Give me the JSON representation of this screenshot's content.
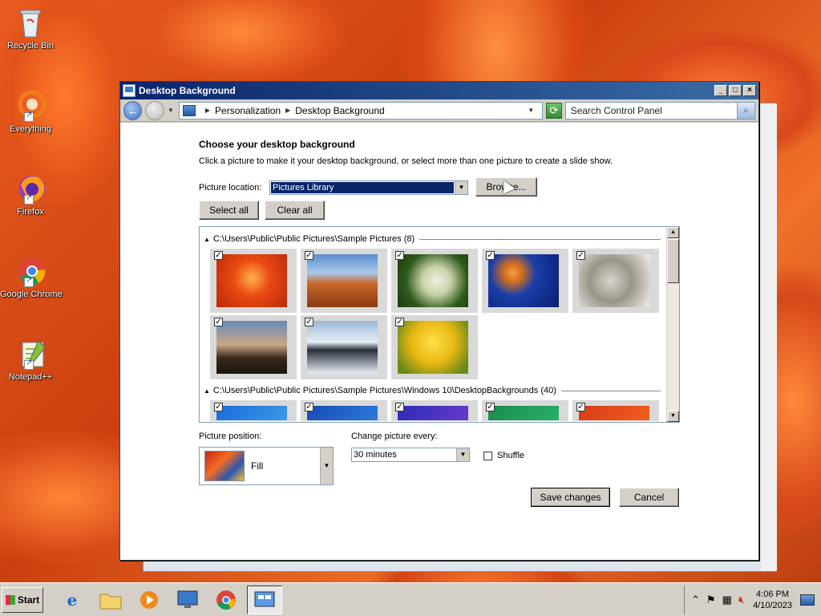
{
  "desktop": {
    "icons": [
      {
        "label": "Recycle Bin"
      },
      {
        "label": "Everything"
      },
      {
        "label": "Firefox"
      },
      {
        "label": "Google Chrome"
      },
      {
        "label": "Notepad++"
      }
    ]
  },
  "window": {
    "title": "Desktop Background",
    "controls": {
      "minimize": "_",
      "maximize": "□",
      "close": "×"
    },
    "address": {
      "crumbs": [
        "Personalization",
        "Desktop Background"
      ]
    },
    "search": {
      "placeholder": "Search Control Panel"
    },
    "heading": "Choose your desktop background",
    "subtext": "Click a picture to make it your desktop background, or select more than one picture to create a slide show.",
    "picture_location": {
      "label": "Picture location:",
      "value": "Pictures Library"
    },
    "browse_label": "Browse...",
    "select_all_label": "Select all",
    "clear_all_label": "Clear all",
    "groups": [
      {
        "header": "C:\\Users\\Public\\Public Pictures\\Sample Pictures (8)",
        "pictures": [
          "chrysanthemum",
          "desert",
          "hydrangeas",
          "jellyfish",
          "koala",
          "lighthouse",
          "penguins",
          "tulips"
        ]
      },
      {
        "header": "C:\\Users\\Public\\Public Pictures\\Sample Pictures\\Windows 10\\DesktopBackgrounds (40)",
        "pictures": [
          "blue",
          "blue-2",
          "blue-purple",
          "green",
          "red"
        ]
      }
    ],
    "picture_position": {
      "label": "Picture position:",
      "value": "Fill"
    },
    "change_every": {
      "label": "Change picture every:",
      "value": "30 minutes"
    },
    "shuffle_label": "Shuffle",
    "save_label": "Save changes",
    "cancel_label": "Cancel"
  },
  "taskbar": {
    "start_label": "Start",
    "clock": {
      "time": "4:06 PM",
      "date": "4/10/2023"
    }
  }
}
